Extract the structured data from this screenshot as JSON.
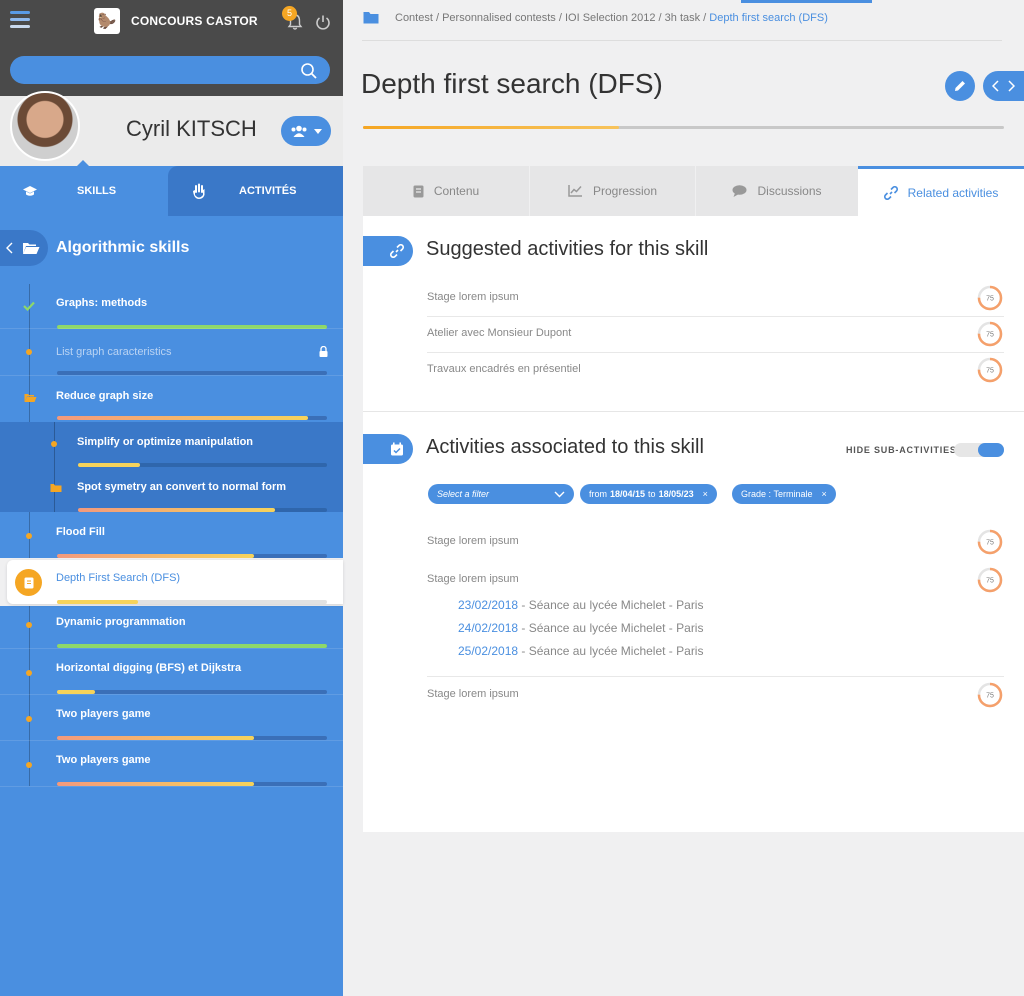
{
  "header": {
    "brand": "CONCOURS CASTOR",
    "notifications": "5",
    "brand_logo_icon": "castor-logo"
  },
  "search": {
    "placeholder": ""
  },
  "profile": {
    "name": "Cyril KITSCH"
  },
  "sidebar_tabs": {
    "skills": "SKILLS",
    "activities": "ACTIVITÉS"
  },
  "skill_header": "Algorithmic skills",
  "skills": [
    {
      "label": "Graphs: methods",
      "progress": 1.0,
      "status": "done"
    },
    {
      "label": "List graph caracteristics",
      "progress": 0,
      "status": "locked"
    },
    {
      "label": "Reduce graph size",
      "progress": 0.93,
      "status": "folder"
    },
    {
      "label": "Simplify or optimize manipulation",
      "progress": 0.25,
      "status": "sub"
    },
    {
      "label": "Spot symetry an convert to normal form",
      "progress": 0.79,
      "status": "sub-folder"
    },
    {
      "label": "Flood Fill",
      "progress": 0.73,
      "status": "normal"
    },
    {
      "label": "Depth First Search (DFS)",
      "progress": 0.3,
      "status": "selected"
    },
    {
      "label": "Dynamic programmation",
      "progress": 1.0,
      "status": "done-bar"
    },
    {
      "label": "Horizontal digging (BFS) et Dijkstra",
      "progress": 0.14,
      "status": "normal"
    },
    {
      "label": "Two players game",
      "progress": 0.73,
      "status": "normal"
    },
    {
      "label": "Two players game",
      "progress": 0.73,
      "status": "normal"
    }
  ],
  "breadcrumb": {
    "path": "Contest / Personnalised contests / IOI Selection 2012 / 3h task / ",
    "current": "Depth first search (DFS)"
  },
  "page": {
    "title": "Depth first search (DFS)",
    "progress": 0.4
  },
  "main_tabs": [
    {
      "label": "Contenu",
      "icon": "book-icon"
    },
    {
      "label": "Progression",
      "icon": "chart-icon"
    },
    {
      "label": "Discussions",
      "icon": "chat-icon"
    },
    {
      "label": "Related activities",
      "icon": "link-icon"
    }
  ],
  "suggested": {
    "title": "Suggested activities for this skill",
    "items": [
      {
        "label": "Stage lorem ipsum",
        "score": "75"
      },
      {
        "label": "Atelier avec Monsieur Dupont",
        "score": "75"
      },
      {
        "label": "Travaux encadrés en présentiel",
        "score": "75"
      }
    ]
  },
  "associated": {
    "title": "Activities associated to this skill",
    "toggle_label": "HIDE SUB-ACTIVITIES",
    "filter_placeholder": "Select a filter",
    "chip_date": {
      "from": "from",
      "start": "18/04/15",
      "to": "to",
      "end": "18/05/23"
    },
    "chip_grade": {
      "label": "Grade :",
      "value": "Terminale"
    },
    "items": [
      {
        "label": "Stage lorem ipsum",
        "score": "75"
      },
      {
        "label": "Stage lorem ipsum",
        "score": "75"
      },
      {
        "label": "Stage lorem ipsum",
        "score": "75"
      }
    ],
    "sessions": [
      {
        "date": "23/02/2018",
        "text": " - Séance au lycée Michelet - Paris"
      },
      {
        "date": "24/02/2018",
        "text": " - Séance au lycée Michelet - Paris"
      },
      {
        "date": "25/02/2018",
        "text": " - Séance au lycée Michelet - Paris"
      }
    ]
  },
  "colors": {
    "accent": "#4a8fe0",
    "orange": "#f5a623",
    "green": "#8ed86a",
    "dark": "#4a4a4a"
  }
}
